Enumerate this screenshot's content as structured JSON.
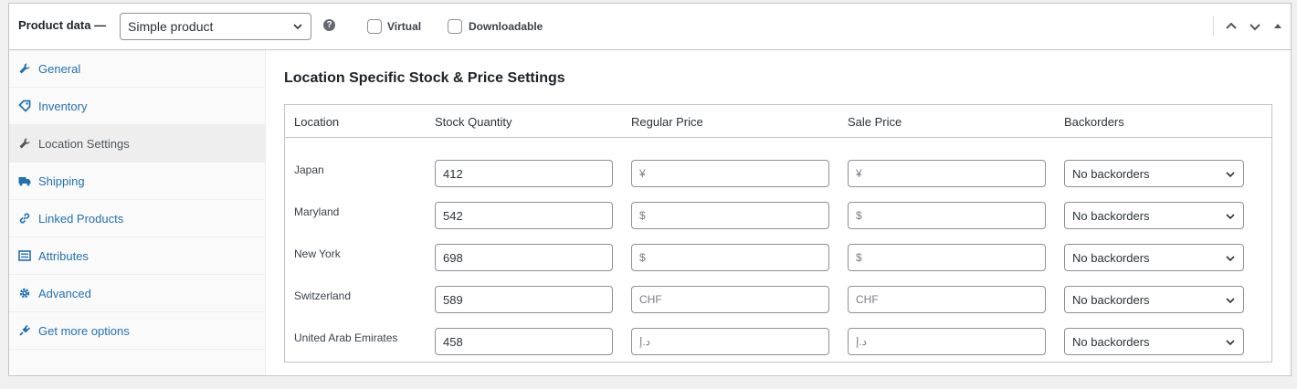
{
  "header": {
    "title": "Product data —",
    "product_type": "Simple product",
    "help_glyph": "?",
    "virtual_label": "Virtual",
    "downloadable_label": "Downloadable"
  },
  "sidebar": {
    "items": [
      {
        "label": "General",
        "icon": "wrench-icon"
      },
      {
        "label": "Inventory",
        "icon": "tag-icon"
      },
      {
        "label": "Location Settings",
        "icon": "wrench-icon",
        "active": true
      },
      {
        "label": "Shipping",
        "icon": "truck-icon"
      },
      {
        "label": "Linked Products",
        "icon": "link-icon"
      },
      {
        "label": "Attributes",
        "icon": "list-icon"
      },
      {
        "label": "Advanced",
        "icon": "gear-icon"
      },
      {
        "label": "Get more options",
        "icon": "plugin-icon"
      }
    ]
  },
  "main": {
    "heading": "Location Specific Stock & Price Settings",
    "columns": [
      "Location",
      "Stock Quantity",
      "Regular Price",
      "Sale Price",
      "Backorders"
    ],
    "rows": [
      {
        "location": "Japan",
        "stock": "412",
        "regular_placeholder": "¥",
        "sale_placeholder": "¥",
        "backorders": "No backorders"
      },
      {
        "location": "Maryland",
        "stock": "542",
        "regular_placeholder": "$",
        "sale_placeholder": "$",
        "backorders": "No backorders"
      },
      {
        "location": "New York",
        "stock": "698",
        "regular_placeholder": "$",
        "sale_placeholder": "$",
        "backorders": "No backorders"
      },
      {
        "location": "Switzerland",
        "stock": "589",
        "regular_placeholder": "CHF",
        "sale_placeholder": "CHF",
        "backorders": "No backorders"
      },
      {
        "location": "United Arab Emirates",
        "stock": "458",
        "regular_placeholder": "د.إ",
        "sale_placeholder": "د.إ",
        "backorders": "No backorders"
      }
    ]
  },
  "colors": {
    "link": "#2271b1",
    "border": "#c3c4c7",
    "sidebar_bg": "#fafafa",
    "active_tab_bg": "#eeeeee"
  }
}
